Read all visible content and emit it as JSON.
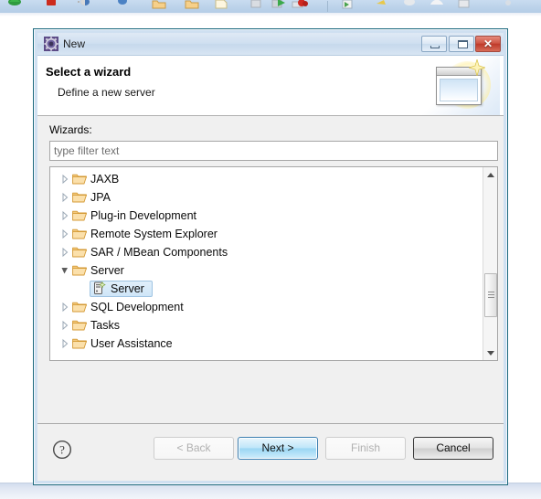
{
  "ide": {
    "toolbar_icons": [
      "back-navigation-icon",
      "stop-icon",
      "debug-icon",
      "run-icon",
      "run-history-icon",
      "new-folder-icon",
      "new-folder-alt-icon",
      "new-file-icon",
      "save-icon",
      "save-all-icon",
      "print-icon",
      "run-green-icon",
      "stop-red-icon",
      "search-icon",
      "external-tools-icon",
      "quick-access-icon",
      "perspective-icon",
      "open-type-icon",
      "misc-icon"
    ]
  },
  "dialog": {
    "title": "New",
    "title_icon": "new-wizard-gear-icon",
    "window_buttons": {
      "minimize": "minimize-icon",
      "maximize": "maximize-icon",
      "close": "close-icon",
      "close_glyph": "✕"
    },
    "banner": {
      "title": "Select a wizard",
      "subtitle": "Define a new server",
      "image": "wizard-banner-window-sparkle"
    },
    "content": {
      "wizards_label": "Wizards:",
      "filter": {
        "value": "",
        "placeholder": "type filter text"
      },
      "tree": [
        {
          "label": "JAXB",
          "level": 0,
          "expanded": false,
          "selected": false,
          "icon": "folder-icon"
        },
        {
          "label": "JPA",
          "level": 0,
          "expanded": false,
          "selected": false,
          "icon": "folder-icon"
        },
        {
          "label": "Plug-in Development",
          "level": 0,
          "expanded": false,
          "selected": false,
          "icon": "folder-icon"
        },
        {
          "label": "Remote System Explorer",
          "level": 0,
          "expanded": false,
          "selected": false,
          "icon": "folder-icon"
        },
        {
          "label": "SAR / MBean Components",
          "level": 0,
          "expanded": false,
          "selected": false,
          "icon": "folder-icon"
        },
        {
          "label": "Server",
          "level": 0,
          "expanded": true,
          "selected": false,
          "icon": "folder-icon"
        },
        {
          "label": "Server",
          "level": 1,
          "expanded": null,
          "selected": true,
          "icon": "server-wizard-icon"
        },
        {
          "label": "SQL Development",
          "level": 0,
          "expanded": false,
          "selected": false,
          "icon": "folder-icon"
        },
        {
          "label": "Tasks",
          "level": 0,
          "expanded": false,
          "selected": false,
          "icon": "folder-icon"
        },
        {
          "label": "User Assistance",
          "level": 0,
          "expanded": false,
          "selected": false,
          "icon": "folder-icon"
        }
      ],
      "scrollbar": {
        "up_arrow": "scroll-up-arrow-icon",
        "down_arrow": "scroll-down-arrow-icon"
      }
    },
    "footer": {
      "help_icon": "help-question-icon",
      "help_glyph": "?",
      "buttons": {
        "back": {
          "label": "< Back",
          "enabled": false
        },
        "next": {
          "label": "Next >",
          "enabled": true,
          "primary": true
        },
        "finish": {
          "label": "Finish",
          "enabled": false
        },
        "cancel": {
          "label": "Cancel",
          "enabled": true
        }
      }
    }
  },
  "colors": {
    "dialog_border": "#1d6a7e",
    "title_bar": "#cfdff0",
    "selection_fill": "#cfe6f8",
    "selection_border": "#9fc4e2",
    "primary_button": "#9ad6f3",
    "folder": "#f0c070",
    "close_button": "#be3a2a"
  }
}
